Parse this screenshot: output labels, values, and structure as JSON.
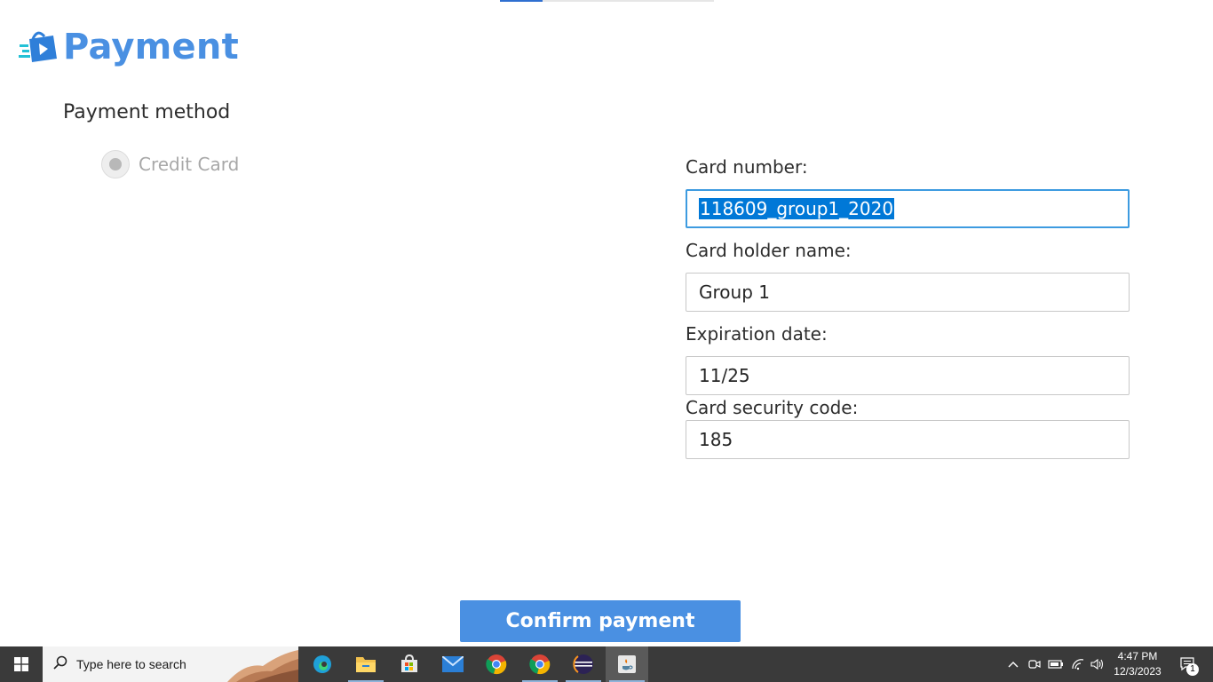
{
  "header": {
    "title": "Payment"
  },
  "payment_method": {
    "label": "Payment method",
    "options": [
      {
        "label": "Credit Card",
        "selected": true,
        "disabled": true
      }
    ]
  },
  "form": {
    "card_number": {
      "label": "Card number:",
      "value": "118609_group1_2020"
    },
    "card_holder": {
      "label": "Card holder name:",
      "value": "Group 1"
    },
    "expiration": {
      "label": "Expiration date:",
      "value": "11/25"
    },
    "security_code": {
      "label": "Card security code:",
      "value": "185"
    }
  },
  "actions": {
    "confirm_label": "Confirm payment"
  },
  "taskbar": {
    "search_placeholder": "Type here to search",
    "apps": [
      "edge-icon",
      "file-explorer-icon",
      "store-icon",
      "mail-icon",
      "chrome-icon",
      "chrome-icon",
      "eclipse-icon",
      "java-icon"
    ],
    "time": "4:47 PM",
    "date": "12/3/2023",
    "notification_count": "1"
  },
  "colors": {
    "accent": "#4a90e2",
    "selection": "#0078d7",
    "focus_border": "#3d9be0",
    "taskbar": "#3a3a3a"
  }
}
